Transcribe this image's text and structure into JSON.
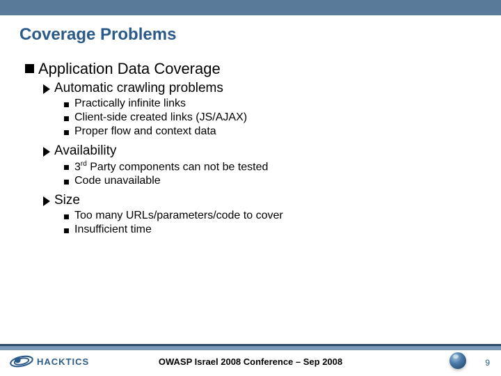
{
  "title": "Coverage Problems",
  "heading1": "Application Data Coverage",
  "sub1": "Automatic crawling problems",
  "sub1_items": {
    "a": "Practically infinite links",
    "b": "Client-side created links (JS/AJAX)",
    "c": "Proper flow and context data"
  },
  "sub2": "Availability",
  "sub2_items": {
    "a_pre": "3",
    "a_sup": "rd",
    "a_post": " Party components can not be tested",
    "b": "Code unavailable"
  },
  "sub3": "Size",
  "sub3_items": {
    "a": "Too many URLs/parameters/code to cover",
    "b": "Insufficient time"
  },
  "footer": {
    "text": "OWASP Israel 2008 Conference – Sep 2008",
    "page": "9",
    "logo_text": "HACKTICS"
  }
}
